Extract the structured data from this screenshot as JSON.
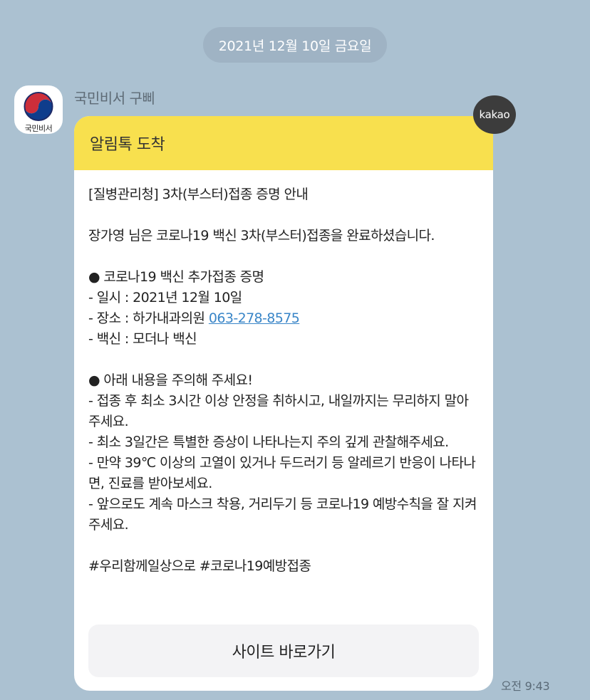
{
  "date_divider": "2021년 12월 10일 금요일",
  "sender": {
    "name": "국민비서 구삐",
    "avatar_label": "국민비서",
    "avatar_icon": "korea-government-taegeuk-icon"
  },
  "badge": "kakao",
  "message": {
    "header": "알림톡 도착",
    "title": "[질병관리청] 3차(부스터)접종 증명 안내",
    "intro": "장가영 님은 코로나19 백신 3차(부스터)접종을 완료하셨습니다.",
    "cert_heading": "● 코로나19 백신 추가접종 증명",
    "date_line": "- 일시 : 2021년 12월 10일",
    "place_prefix": "- 장소 : 하가내과의원 ",
    "phone": "063-278-8575",
    "vaccine_line": "- 백신 : 모더나 백신",
    "caution_heading": "● 아래 내용을 주의해 주세요!",
    "cautions": [
      "- 접종 후 최소 3시간 이상 안정을 취하시고, 내일까지는 무리하지 말아주세요.",
      "- 최소 3일간은 특별한 증상이 나타나는지 주의 깊게 관찰해주세요.",
      "- 만약 39℃ 이상의 고열이 있거나 두드러기 등 알레르기 반응이 나타나면, 진료를 받아보세요.",
      "- 앞으로도 계속 마스크 착용, 거리두기 등 코로나19 예방수칙을 잘 지켜주세요."
    ],
    "hashtags": "#우리함께일상으로 #코로나19예방접종",
    "button_label": "사이트 바로가기"
  },
  "time": "오전 9:43",
  "colors": {
    "background": "#abc1d1",
    "header_yellow": "#f8e04e",
    "link_blue": "#3a86c8",
    "badge_dark": "#3c3c3c"
  }
}
